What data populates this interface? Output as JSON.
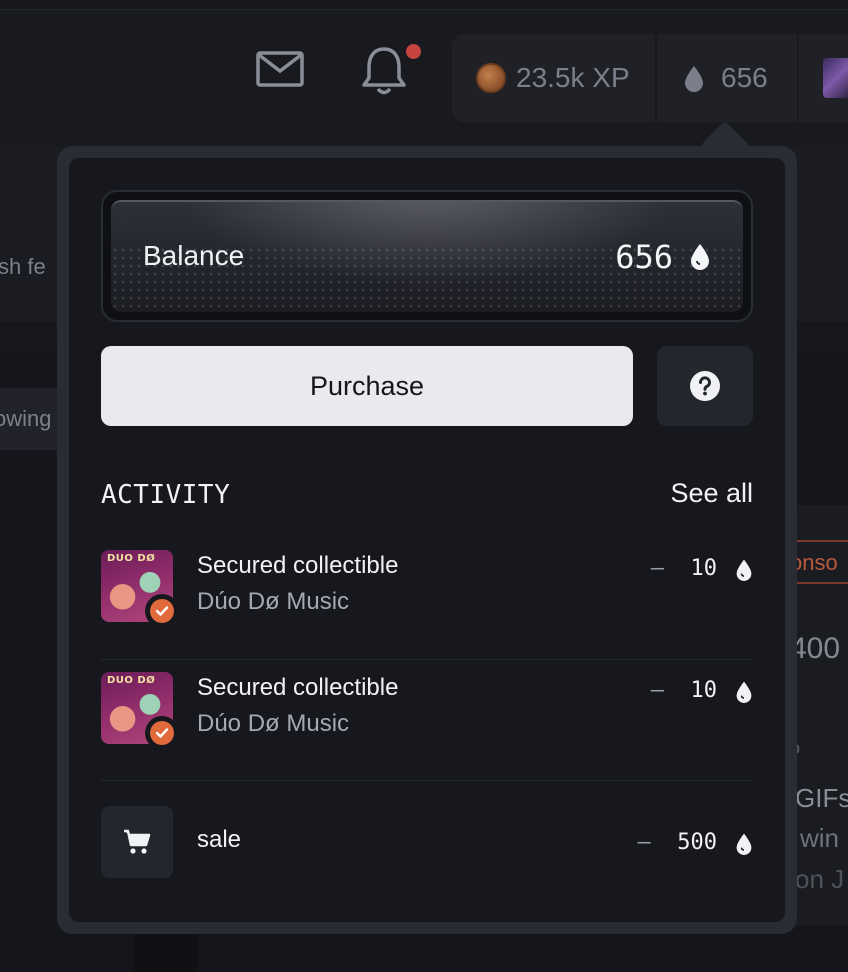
{
  "header": {
    "xp_label": "23.5k XP",
    "drops_label": "656",
    "icons": [
      "mail-icon",
      "bell-icon",
      "xp-coin-icon",
      "drop-icon"
    ],
    "notification_dot_color": "#c6453e"
  },
  "background": {
    "fresh_text": "sh fe",
    "following_text": "owing",
    "sponsored_text": "onso",
    "number_text": "400",
    "mark_text": "o",
    "gifs_text": "GIFs",
    "win_text": "win",
    "on_text": "on J"
  },
  "wallet": {
    "balance_label": "Balance",
    "balance_value": "656",
    "purchase_label": "Purchase",
    "help_icon": "question-circle-icon",
    "activity_title": "ACTIVITY",
    "see_all_label": "See all",
    "activity": [
      {
        "title": "Secured collectible",
        "subtitle": "Dúo Dø Music",
        "thumb_text": "DUO DØ",
        "sign": "–",
        "amount": "10"
      },
      {
        "title": "Secured collectible",
        "subtitle": "Dúo Dø Music",
        "thumb_text": "DUO DØ",
        "sign": "–",
        "amount": "10"
      },
      {
        "title": "sale",
        "sign": "–",
        "amount": "500",
        "icon": "cart-icon"
      }
    ]
  },
  "colors": {
    "badge": "#e06a3c",
    "purchase_bg": "#e9eaee",
    "popover_border": "#2a2c33"
  }
}
